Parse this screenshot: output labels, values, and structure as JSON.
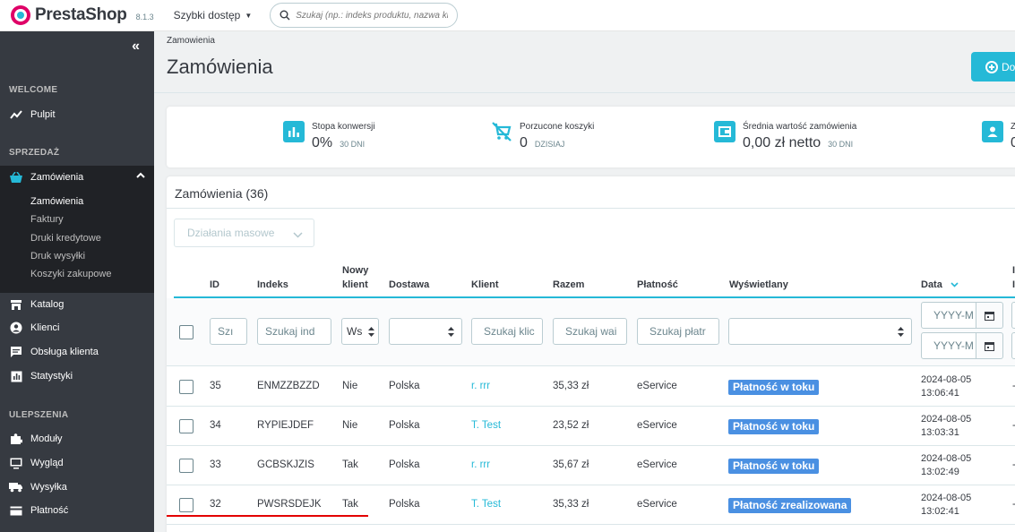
{
  "header": {
    "brand": "PrestaShop",
    "version": "8.1.3",
    "quick_access": "Szybki dostęp",
    "search_placeholder": "Szukaj (np.: indeks produktu, nazwa klienta...)"
  },
  "sidebar": {
    "collapse_glyph": "«",
    "sections": {
      "welcome": "WELCOME",
      "sales": "SPRZEDAŻ",
      "improve": "ULEPSZENIA"
    },
    "dashboard": "Pulpit",
    "orders": "Zamówienia",
    "orders_sub": [
      "Zamówienia",
      "Faktury",
      "Druki kredytowe",
      "Druk wysyłki",
      "Koszyki zakupowe"
    ],
    "catalog": "Katalog",
    "customers": "Klienci",
    "customer_service": "Obsługa klienta",
    "stats": "Statystyki",
    "modules": "Moduły",
    "design": "Wygląd",
    "shipping": "Wysyłka",
    "payment": "Płatność"
  },
  "page": {
    "breadcrumb": "Zamowienia",
    "title": "Zamówienia",
    "add_button": "Do"
  },
  "kpis": [
    {
      "label": "Stopa konwersji",
      "value": "0%",
      "period": "30 DNI",
      "icon": "bar-chart-icon"
    },
    {
      "label": "Porzucone koszyki",
      "value": "0",
      "period": "DZISIAJ",
      "icon": "cart-off-icon"
    },
    {
      "label": "Średnia wartość zamówienia",
      "value": "0,00 zł netto",
      "period": "30 DNI",
      "icon": "wallet-icon"
    },
    {
      "label": "Zy",
      "value": "0",
      "icon": "person-icon"
    }
  ],
  "orders": {
    "heading": "Zamówienia (36)",
    "bulk_actions": "Działania masowe",
    "columns": {
      "id": "ID",
      "reference": "Indeks",
      "new_client_1": "Nowy",
      "new_client_2": "klient",
      "delivery": "Dostawa",
      "customer": "Klient",
      "total": "Razem",
      "payment": "Płatność",
      "status": "Wyświetlany",
      "date": "Data",
      "extra_1": "I",
      "extra_2": "I"
    },
    "filters": {
      "id": "Szı",
      "reference": "Szukaj ind",
      "new_client": "Ws",
      "delivery": "",
      "customer": "Szukaj klic",
      "total": "Szukaj wai",
      "payment": "Szukaj płatr",
      "status": "",
      "date_from": "YYYY-M",
      "date_to": "YYYY-M"
    },
    "rows": [
      {
        "id": "35",
        "reference": "ENMZZBZZD",
        "new_client": "Nie",
        "delivery": "Polska",
        "customer": "r. rrr",
        "total": "35,33 zł",
        "payment": "eService",
        "status": "Płatność w toku",
        "date": "2024-08-05",
        "time": "13:06:41",
        "extra": "-"
      },
      {
        "id": "34",
        "reference": "RYPIEJDEF",
        "new_client": "Nie",
        "delivery": "Polska",
        "customer": "T. Test",
        "total": "23,52 zł",
        "payment": "eService",
        "status": "Płatność w toku",
        "date": "2024-08-05",
        "time": "13:03:31",
        "extra": "-"
      },
      {
        "id": "33",
        "reference": "GCBSKJZIS",
        "new_client": "Tak",
        "delivery": "Polska",
        "customer": "r. rrr",
        "total": "35,67 zł",
        "payment": "eService",
        "status": "Płatność w toku",
        "date": "2024-08-05",
        "time": "13:02:49",
        "extra": "-"
      },
      {
        "id": "32",
        "reference": "PWSRSDEJK",
        "new_client": "Tak",
        "delivery": "Polska",
        "customer": "T. Test",
        "total": "35,33 zł",
        "payment": "eService",
        "status": "Płatność zrealizowana",
        "date": "2024-08-05",
        "time": "13:02:41",
        "extra": "-"
      }
    ]
  },
  "colors": {
    "accent": "#25b9d7",
    "sidebar": "#363a41",
    "status_badge": "#4a90e2",
    "annotation_underline": "#e30000"
  }
}
